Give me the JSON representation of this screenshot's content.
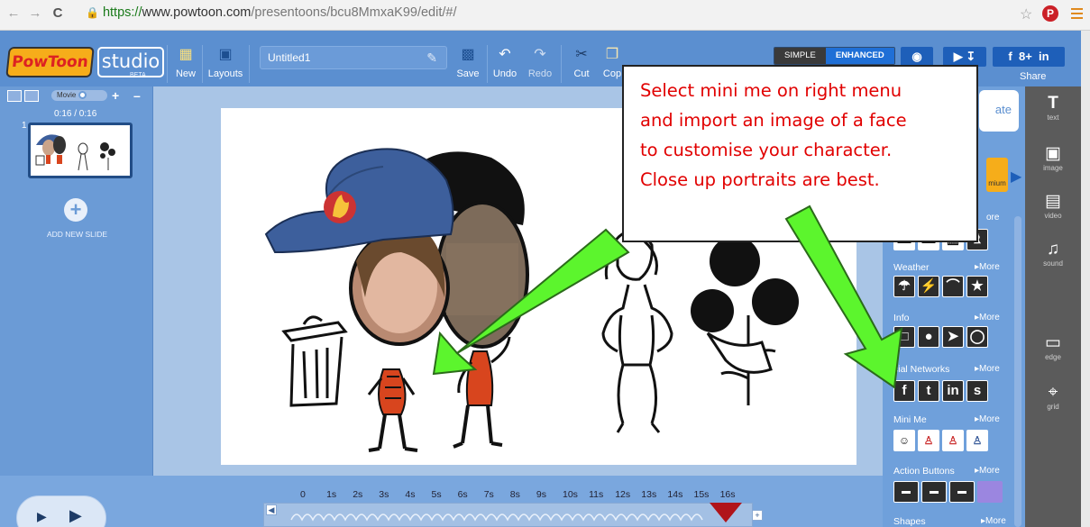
{
  "browser": {
    "url_https": "https://",
    "url_host": "www.powtoon.com",
    "url_path": "/presentoons/bcu8MmxaK99/edit/#/"
  },
  "header": {
    "logo_pow": "PowToon",
    "logo_studio": "studio",
    "beta": "BETA",
    "new_label": "New",
    "layouts_label": "Layouts",
    "title_value": "Untitled1",
    "save_label": "Save",
    "undo_label": "Undo",
    "redo_label": "Redo",
    "cut_label": "Cut",
    "copy_label": "Cop",
    "mode_simple": "SIMPLE",
    "mode_enhanced": "ENHANCED",
    "share_label": "Share"
  },
  "slides": {
    "movie_label": "Movie",
    "time": "0:16 / 0:16",
    "slide_number": "1",
    "add_slide": "ADD NEW SLIDE"
  },
  "library": {
    "create_partial": "ate",
    "more_partial": "ore",
    "more_label": "More",
    "premium_partial": "mium",
    "categories": [
      {
        "name": "Weather",
        "more": "More"
      },
      {
        "name": "Info",
        "more": "More"
      },
      {
        "name": "cial Networks",
        "more": "More"
      },
      {
        "name": "Mini Me",
        "more": "More"
      },
      {
        "name": "Action Buttons",
        "more": "More"
      },
      {
        "name": "Shapes",
        "more": "More"
      }
    ],
    "social_icons": [
      "f",
      "t",
      "in",
      "s"
    ]
  },
  "tools": [
    {
      "label": "text",
      "icon": "text-icon"
    },
    {
      "label": "image",
      "icon": "image-icon"
    },
    {
      "label": "video",
      "icon": "video-icon"
    },
    {
      "label": "sound",
      "icon": "sound-icon"
    },
    {
      "label": "edge",
      "icon": "edge-icon"
    },
    {
      "label": "grid",
      "icon": "grid-icon"
    }
  ],
  "timeline": {
    "seconds": [
      "0",
      "1s",
      "2s",
      "3s",
      "4s",
      "5s",
      "6s",
      "7s",
      "8s",
      "9s",
      "10s",
      "11s",
      "12s",
      "13s",
      "14s",
      "15s",
      "16s"
    ]
  },
  "callout": {
    "lines": [
      "Select mini me on right menu",
      "and import an image of a face",
      "to customise your character.",
      "Close up portraits are best."
    ]
  },
  "colors": {
    "header_blue": "#5b8fd0",
    "arrow_green": "#5cf52d",
    "callout_text": "#e10000",
    "playhead_red": "#b0141a"
  }
}
